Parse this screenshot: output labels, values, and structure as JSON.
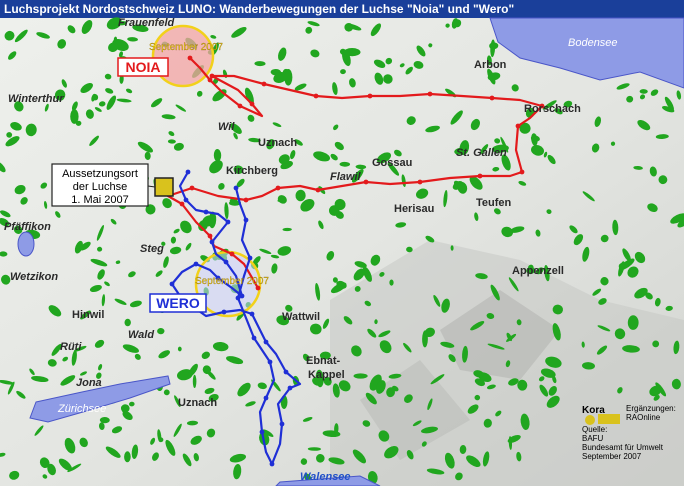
{
  "title": "Luchsprojekt  Nordostschweiz LUNO:  Wanderbewegungen der Luchse \"Noia\" und \"Wero\"",
  "lynx": {
    "noia": {
      "name": "NOIA",
      "date": "September 2007",
      "color": "#e31a1c"
    },
    "wero": {
      "name": "WERO",
      "date": "September 2007",
      "color": "#1f2fd6"
    }
  },
  "release": {
    "lines": [
      "Aussetzungsort",
      "der Luchse",
      "1. Mai 2007"
    ]
  },
  "places": {
    "frauenfeld": "Frauenfeld",
    "arbon": "Arbon",
    "winterthur": "Winterthur",
    "rorschach": "Rorschach",
    "wil": "Wil",
    "uznach_n": "Uznach",
    "gossau": "Gossau",
    "stgallen": "St. Gallen",
    "kirchberg": "Kirchberg",
    "flawil": "Flawil",
    "herisau": "Herisau",
    "teufen": "Teufen",
    "pfaeffikon": "Pfäffikon",
    "steg": "Steg",
    "wetzikon": "Wetzikon",
    "appenzell": "Appenzell",
    "hinwil": "Hinwil",
    "wald": "Wald",
    "wattwil": "Wattwil",
    "rueti": "Rüti",
    "ebnat": "Ebnat-",
    "kappel": "Kappel",
    "jona": "Jona",
    "uznach_s": "Uznach"
  },
  "waters": {
    "bodensee": "Bodensee",
    "zuerichsee": "Zürichsee",
    "walensee": "Walensee"
  },
  "credits": {
    "logo": "Kora",
    "ergaenzungen": "Ergänzungen:",
    "raonline": "RAOnline",
    "quelle": "Quelle:",
    "bafu": "BAFU",
    "bundesamt": "Bundesamt für Umwelt",
    "datum": "September 2007"
  }
}
